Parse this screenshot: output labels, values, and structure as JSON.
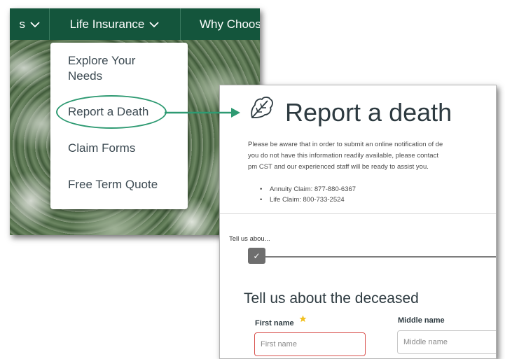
{
  "navbar": {
    "left_item_label": "s",
    "life_label": "Life Insurance",
    "why_label": "Why Choos"
  },
  "dropdown": {
    "items": [
      {
        "label": "Explore Your Needs"
      },
      {
        "label": "Report a Death"
      },
      {
        "label": "Claim Forms"
      },
      {
        "label": "Free Term Quote"
      }
    ]
  },
  "form": {
    "title": "Report a death",
    "notice_lines": [
      "Please be aware that in order to submit an online notification of de",
      "you do not have this information readily available, please contact",
      "pm CST and our experienced staff will be ready to assist you."
    ],
    "phones": [
      "Annuity Claim: 877-880-6367",
      "Life Claim: 800-733-2524"
    ],
    "progress_label": "Tell us abou...",
    "step_check": "✓",
    "section_title": "Tell us about the deceased",
    "first_name_label": "First name",
    "first_name_placeholder": "First name",
    "middle_name_label": "Middle name",
    "middle_name_placeholder": "Middle name"
  },
  "colors": {
    "nav_green": "#14553c",
    "highlight_green": "#2e9a72",
    "required_star": "#f2c01e",
    "error_border": "#d9534f"
  },
  "icons": {
    "nav_chevron": "chevron-down-icon",
    "form_logo": "leaf-icon",
    "step": "checkmark-icon",
    "required": "star-icon",
    "connector": "arrow-right-icon"
  }
}
